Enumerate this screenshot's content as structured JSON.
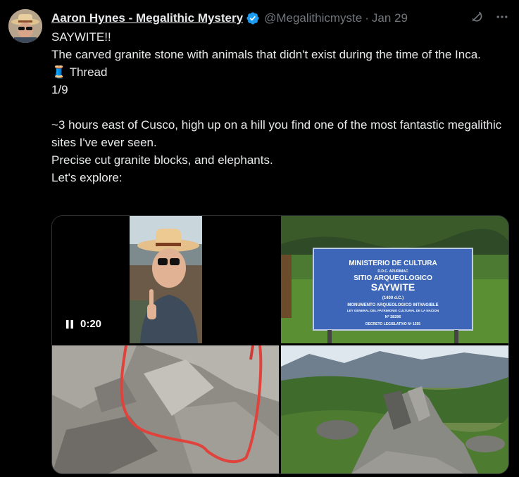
{
  "tweet": {
    "author_name": "Aaron Hynes - Megalithic Mystery",
    "handle": "@Megalithicmyste",
    "separator": "·",
    "date": "Jan 29",
    "lines": [
      "SAYWITE!!",
      "The carved granite stone with animals that didn't exist during the time of the Inca.",
      "Thread",
      "1/9",
      "",
      "~3 hours east of Cusco, high up on a hill you find one of the most fantastic megalithic sites I've ever seen.",
      "Precise cut granite blocks, and elephants.",
      "Let's explore:"
    ],
    "thread_emoji": "🧵"
  },
  "media": {
    "video_time": "0:20",
    "sign": {
      "line1": "MINISTERIO DE CULTURA",
      "line2": "D.D.C. APURIMAC",
      "line3": "SITIO ARQUEOLOGICO",
      "line4": "SAYWITE",
      "line5": "(1400 d.C.)",
      "line6": "MONUMENTO ARQUEOLOGICO INTANGIBLE",
      "line7": "LEY GENERAL DEL PATRIMONIO CULTURAL DE LA NACION",
      "line8": "Nº 28296",
      "line9": "DECRETO LEGISLATIVO Nº 1255"
    }
  },
  "icons": {
    "verified": "verified-badge-icon",
    "grok": "grok-icon",
    "more": "more-icon",
    "pause": "pause-icon"
  },
  "colors": {
    "background": "#000000",
    "text": "#e7e9ea",
    "muted": "#71767b",
    "verified": "#1d9bf0"
  }
}
